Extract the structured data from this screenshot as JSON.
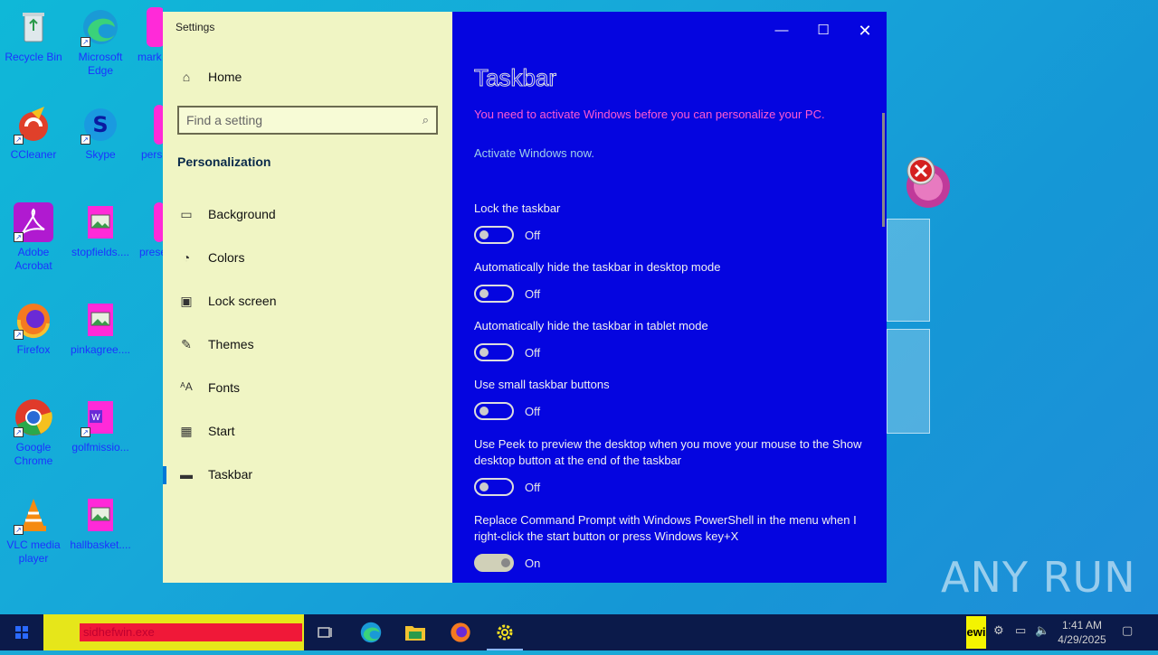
{
  "desktop": {
    "icons": [
      {
        "label": "Recycle Bin"
      },
      {
        "label": "Microsoft Edge"
      },
      {
        "label": "mark"
      },
      {
        "label": "CCleaner"
      },
      {
        "label": "Skype"
      },
      {
        "label": "pers"
      },
      {
        "label": "Adobe Acrobat"
      },
      {
        "label": "stopfields...."
      },
      {
        "label": "prese"
      },
      {
        "label": "Firefox"
      },
      {
        "label": "pinkagree...."
      },
      {
        "label": "Google Chrome"
      },
      {
        "label": "golfmissio..."
      },
      {
        "label": "VLC media player"
      },
      {
        "label": "hallbasket...."
      }
    ],
    "watermark": "ANY RUN"
  },
  "settings": {
    "window_title": "Settings",
    "nav": {
      "home": "Home",
      "search_placeholder": "Find a setting",
      "section": "Personalization",
      "items": [
        {
          "label": "Background",
          "icon": "image-icon"
        },
        {
          "label": "Colors",
          "icon": "palette-icon"
        },
        {
          "label": "Lock screen",
          "icon": "lock-screen-icon"
        },
        {
          "label": "Themes",
          "icon": "themes-icon"
        },
        {
          "label": "Fonts",
          "icon": "fonts-icon"
        },
        {
          "label": "Start",
          "icon": "start-icon"
        },
        {
          "label": "Taskbar",
          "icon": "taskbar-icon"
        }
      ],
      "selected": "Taskbar"
    },
    "content": {
      "title": "Taskbar",
      "warning": "You need to activate Windows before you can personalize your PC.",
      "activate_link": "Activate Windows now.",
      "settings": [
        {
          "label": "Lock the taskbar",
          "state": "Off"
        },
        {
          "label": "Automatically hide the taskbar in desktop mode",
          "state": "Off"
        },
        {
          "label": "Automatically hide the taskbar in tablet mode",
          "state": "Off"
        },
        {
          "label": "Use small taskbar buttons",
          "state": "Off"
        },
        {
          "label": "Use Peek to preview the desktop when you move your mouse to the Show desktop button at the end of the taskbar",
          "state": "Off"
        },
        {
          "label": "Replace Command Prompt with Windows PowerShell in the menu when I right-click the start button or press Windows key+X",
          "state": "On"
        }
      ]
    }
  },
  "taskbar": {
    "search_text": "sidhefwin.exe",
    "lang": "ewi",
    "time": "1:41 AM",
    "date": "4/29/2025"
  }
}
